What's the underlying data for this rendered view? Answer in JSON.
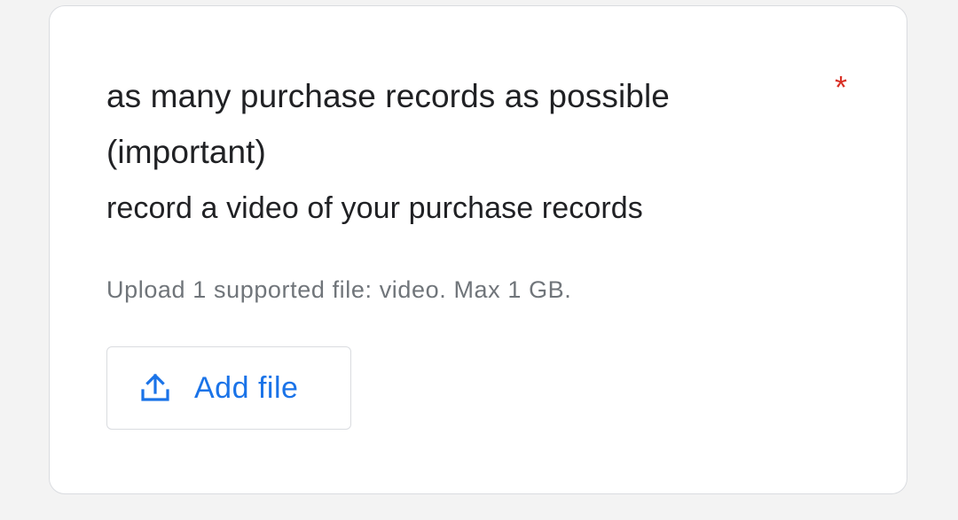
{
  "question": {
    "title": "as many purchase records as possible (important)",
    "required_marker": "*",
    "description": "record a video of your purchase records",
    "upload_hint": "Upload 1 supported file: video. Max 1 GB.",
    "add_file_label": "Add file",
    "add_file_icon": "upload-icon"
  },
  "colors": {
    "accent": "#1a73e8",
    "required": "#d93025",
    "hint_text": "#70757a",
    "body_text": "#202124",
    "background": "#f3f3f3"
  }
}
